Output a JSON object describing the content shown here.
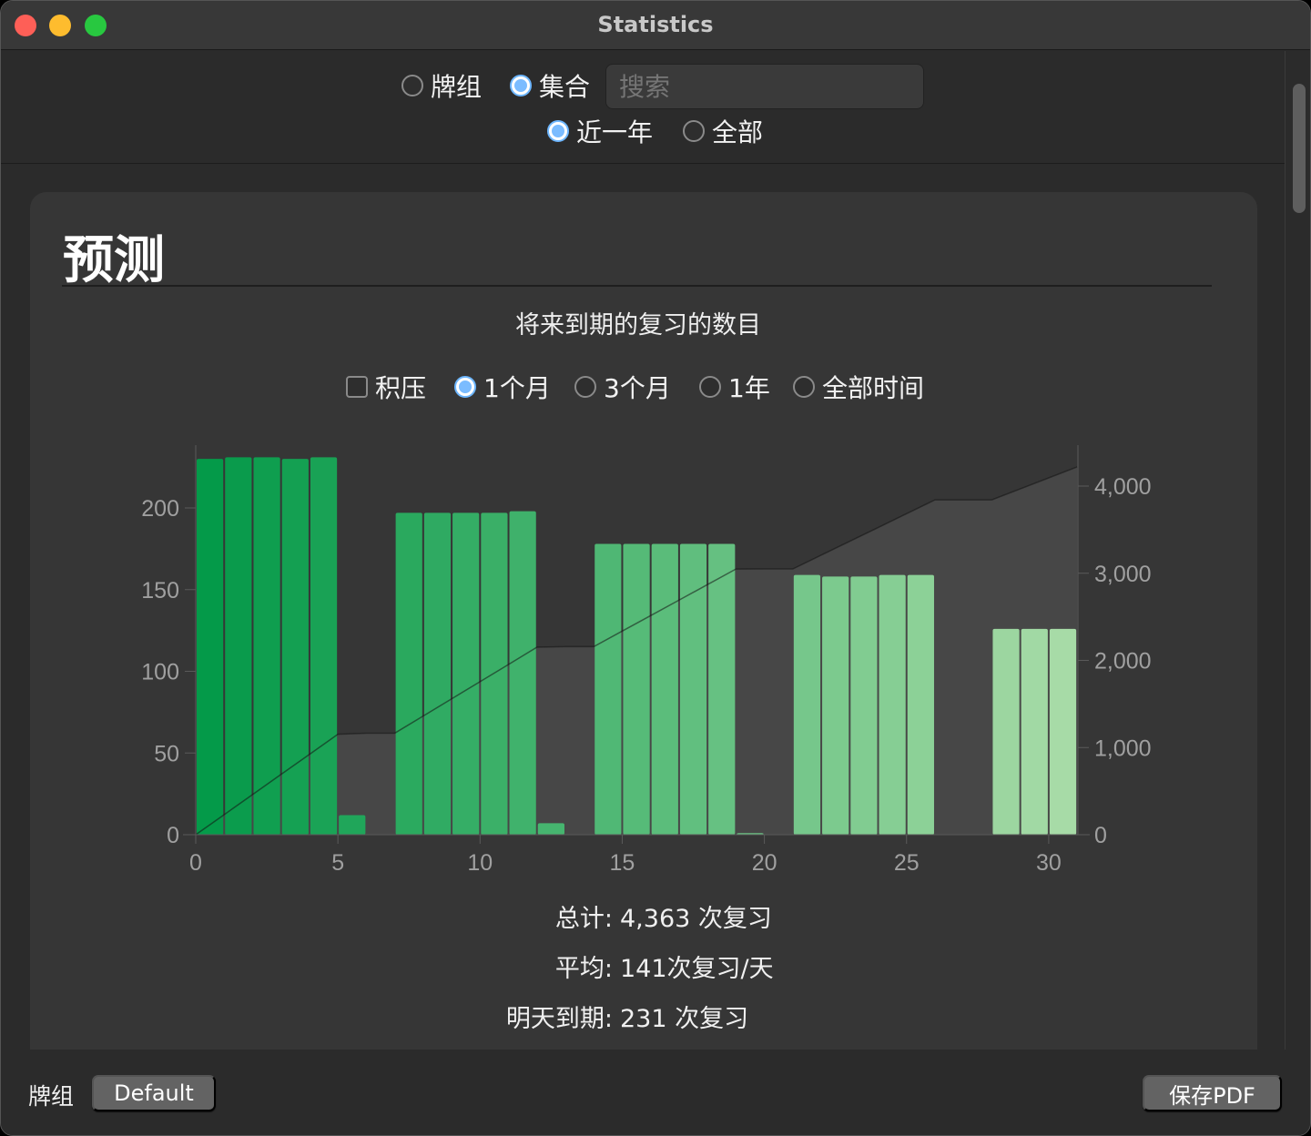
{
  "window": {
    "title": "Statistics"
  },
  "top": {
    "scope_options": [
      {
        "label": "牌组",
        "selected": false
      },
      {
        "label": "集合",
        "selected": true
      }
    ],
    "search_placeholder": "搜索",
    "period_options": [
      {
        "label": "近一年",
        "selected": true
      },
      {
        "label": "全部",
        "selected": false
      }
    ]
  },
  "section": {
    "title": "预测",
    "subtitle": "将来到期的复习的数目",
    "backlog_label": "积压",
    "backlog_checked": false,
    "range_options": [
      {
        "label": "1个月",
        "selected": true
      },
      {
        "label": "3个月",
        "selected": false
      },
      {
        "label": "1年",
        "selected": false
      },
      {
        "label": "全部时间",
        "selected": false
      }
    ]
  },
  "chart_data": {
    "type": "bar",
    "title": "将来到期的复习的数目",
    "xlabel": "",
    "ylabel": "",
    "x": [
      0,
      1,
      2,
      3,
      4,
      5,
      6,
      7,
      8,
      9,
      10,
      11,
      12,
      13,
      14,
      15,
      16,
      17,
      18,
      19,
      20,
      21,
      22,
      23,
      24,
      25,
      26,
      27,
      28,
      29,
      30
    ],
    "values": [
      230,
      231,
      231,
      230,
      231,
      12,
      0,
      197,
      197,
      197,
      197,
      198,
      7,
      0,
      178,
      178,
      178,
      178,
      178,
      1,
      0,
      159,
      158,
      158,
      159,
      159,
      0,
      0,
      126,
      126,
      126
    ],
    "cumulative_series": "running total on right axis",
    "xlim": [
      0,
      31
    ],
    "ylim": [
      0,
      240
    ],
    "y2lim": [
      0,
      4480
    ],
    "x_ticks": [
      "0",
      "5",
      "10",
      "15",
      "20",
      "25",
      "30"
    ],
    "y_ticks": [
      "0",
      "50",
      "100",
      "150",
      "200"
    ],
    "y2_ticks": [
      "0",
      "1,000",
      "2,000",
      "3,000",
      "4,000"
    ],
    "colors": {
      "start": "#00a14a",
      "end": "#aee6ae",
      "area": "#474747"
    }
  },
  "stats": [
    {
      "label": "总计:",
      "value": "4,363 次复习"
    },
    {
      "label": "平均:",
      "value": "141次复习/天"
    },
    {
      "label": "明天到期:",
      "value": "231 次复习"
    }
  ],
  "footer": {
    "deck_label": "牌组",
    "deck_button": "Default",
    "save_pdf": "保存PDF"
  }
}
